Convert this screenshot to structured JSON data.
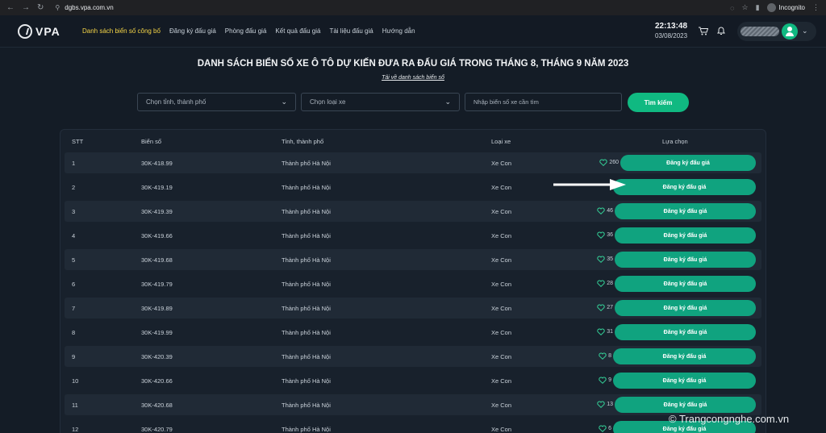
{
  "browser": {
    "url": "dgbs.vpa.com.vn",
    "incognito_label": "Incognito"
  },
  "header": {
    "logo_text": "VPA",
    "menu": [
      {
        "label": "Danh sách biển số công bố",
        "active": true
      },
      {
        "label": "Đăng ký đấu giá",
        "active": false
      },
      {
        "label": "Phòng đấu giá",
        "active": false
      },
      {
        "label": "Kết quả đấu giá",
        "active": false
      },
      {
        "label": "Tài liệu đấu giá",
        "active": false
      },
      {
        "label": "Hướng dẫn",
        "active": false
      }
    ],
    "time": "22:13:48",
    "date": "03/08/2023"
  },
  "page": {
    "title": "DANH SÁCH BIỂN SỐ XE Ô TÔ DỰ KIẾN ĐƯA RA ĐẤU GIÁ TRONG THÁNG 8, THÁNG 9 NĂM 2023",
    "download_link": "Tải về danh sách biển số"
  },
  "filters": {
    "province_placeholder": "Chọn tỉnh, thành phố",
    "vehicle_type_placeholder": "Chọn loại xe",
    "search_placeholder": "Nhập biển số xe cần tìm",
    "search_button": "Tìm kiếm"
  },
  "table": {
    "headers": {
      "stt": "STT",
      "plate": "Biển số",
      "province": "Tỉnh, thành phố",
      "type": "Loại xe",
      "action": "Lựa chọn"
    },
    "button_label": "Đăng ký đấu giá",
    "rows": [
      {
        "stt": "1",
        "plate": "30K-418.99",
        "province": "Thành phố Hà Nội",
        "type": "Xe Con",
        "likes": "260"
      },
      {
        "stt": "2",
        "plate": "30K-419.19",
        "province": "Thành phố Hà Nội",
        "type": "Xe Con",
        "likes": ""
      },
      {
        "stt": "3",
        "plate": "30K-419.39",
        "province": "Thành phố Hà Nội",
        "type": "Xe Con",
        "likes": "46"
      },
      {
        "stt": "4",
        "plate": "30K-419.66",
        "province": "Thành phố Hà Nội",
        "type": "Xe Con",
        "likes": "36"
      },
      {
        "stt": "5",
        "plate": "30K-419.68",
        "province": "Thành phố Hà Nội",
        "type": "Xe Con",
        "likes": "35"
      },
      {
        "stt": "6",
        "plate": "30K-419.79",
        "province": "Thành phố Hà Nội",
        "type": "Xe Con",
        "likes": "28"
      },
      {
        "stt": "7",
        "plate": "30K-419.89",
        "province": "Thành phố Hà Nội",
        "type": "Xe Con",
        "likes": "27"
      },
      {
        "stt": "8",
        "plate": "30K-419.99",
        "province": "Thành phố Hà Nội",
        "type": "Xe Con",
        "likes": "31"
      },
      {
        "stt": "9",
        "plate": "30K-420.39",
        "province": "Thành phố Hà Nội",
        "type": "Xe Con",
        "likes": "8"
      },
      {
        "stt": "10",
        "plate": "30K-420.66",
        "province": "Thành phố Hà Nội",
        "type": "Xe Con",
        "likes": "9"
      },
      {
        "stt": "11",
        "plate": "30K-420.68",
        "province": "Thành phố Hà Nội",
        "type": "Xe Con",
        "likes": "13"
      },
      {
        "stt": "12",
        "plate": "30K-420.79",
        "province": "Thành phố Hà Nội",
        "type": "Xe Con",
        "likes": "6"
      }
    ]
  },
  "watermark": "© Trangcongnghe.com.vn",
  "colors": {
    "accent": "#10b981",
    "active_menu": "#f5d547",
    "background": "#141c26"
  }
}
